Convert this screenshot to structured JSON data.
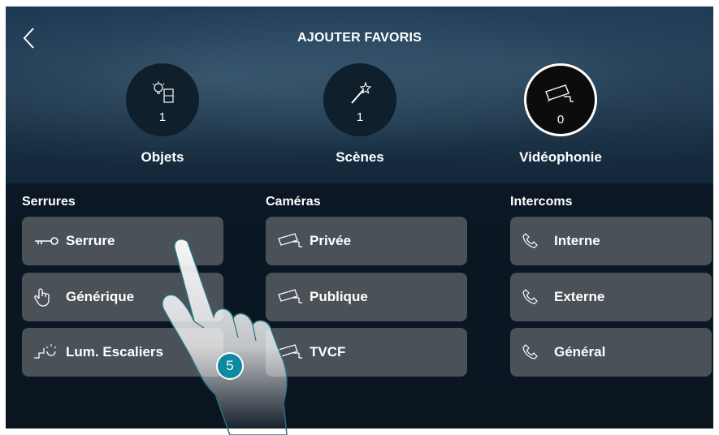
{
  "header": {
    "title": "AJOUTER FAVORIS"
  },
  "categories": [
    {
      "label": "Objets",
      "count": "1",
      "icon": "bulb-switch-icon",
      "active": false
    },
    {
      "label": "Scènes",
      "count": "1",
      "icon": "magic-wand-icon",
      "active": false
    },
    {
      "label": "Vidéophonie",
      "count": "0",
      "icon": "camera-icon",
      "active": true
    }
  ],
  "columns": {
    "serrures": {
      "title": "Serrures",
      "items": [
        {
          "label": "Serrure",
          "icon": "key-icon"
        },
        {
          "label": "Générique",
          "icon": "hand-pointer-icon"
        },
        {
          "label": "Lum. Escaliers",
          "icon": "stair-light-icon"
        }
      ]
    },
    "cameras": {
      "title": "Caméras",
      "items": [
        {
          "label": "Privée",
          "icon": "camera-icon"
        },
        {
          "label": "Publique",
          "icon": "camera-icon"
        },
        {
          "label": "TVCF",
          "icon": "camera-icon"
        }
      ]
    },
    "intercoms": {
      "title": "Intercoms",
      "items": [
        {
          "label": "Interne",
          "icon": "phone-icon"
        },
        {
          "label": "Externe",
          "icon": "phone-icon"
        },
        {
          "label": "Général",
          "icon": "phone-icon"
        }
      ]
    }
  },
  "step_badge": "5",
  "colors": {
    "button_bg": "#4a5157",
    "badge": "#0c8aa0",
    "background": "#0f1f2c"
  }
}
